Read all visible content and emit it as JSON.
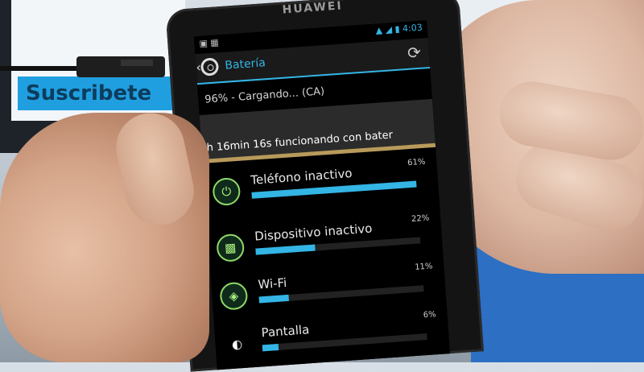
{
  "background": {
    "banner_text": "Suscribete"
  },
  "device": {
    "brand": "HUAWEI"
  },
  "status_bar": {
    "time": "4:03"
  },
  "app": {
    "title": "Batería",
    "charge_status": "96% - Cargando... (CA)",
    "uptime_text": "2h 16min 16s funcionando con bater",
    "accent_color": "#33b5e5"
  },
  "usage": [
    {
      "label": "Teléfono inactivo",
      "percent_label": "61%",
      "percent": 61,
      "icon": "power-icon"
    },
    {
      "label": "Dispositivo inactivo",
      "percent_label": "22%",
      "percent": 22,
      "icon": "signal-bars-icon"
    },
    {
      "label": "Wi-Fi",
      "percent_label": "11%",
      "percent": 11,
      "icon": "wifi-icon"
    },
    {
      "label": "Pantalla",
      "percent_label": "6%",
      "percent": 6,
      "icon": "brightness-icon"
    }
  ]
}
